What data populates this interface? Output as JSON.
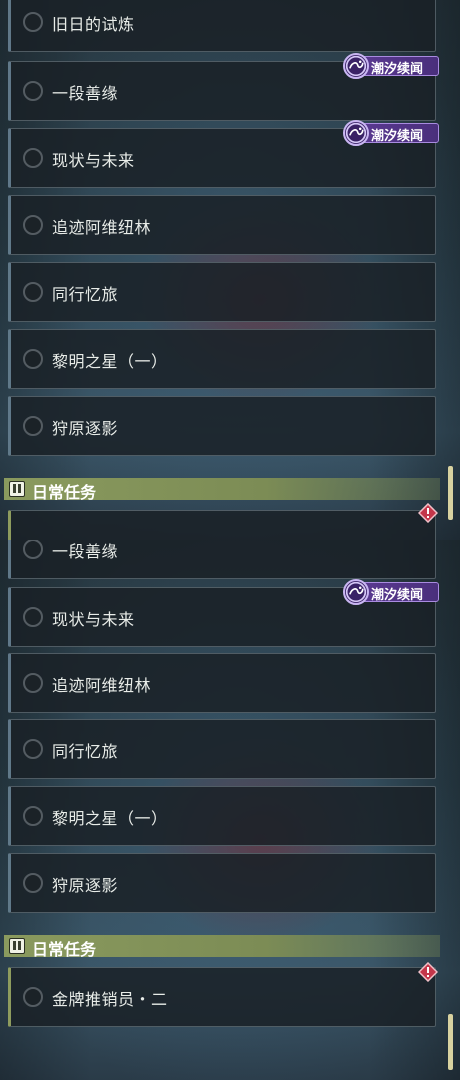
{
  "badge_label": "潮汐续闻",
  "section_daily": "日常任务",
  "colors": {
    "badge_purple": "#5b3a92",
    "section_green": "#8a9a5e",
    "warn_red": "#c4364a",
    "item_background": "#1a2126"
  },
  "icons": {
    "radio": "empty-circle-icon",
    "badge": "tide-swirl-icon",
    "section": "double-bar-quest-icon",
    "warning": "red-diamond-alert-icon"
  },
  "top_list": {
    "items": [
      {
        "title": "旧日的试炼"
      },
      {
        "title": "一段善缘"
      },
      {
        "title": "现状与未来"
      },
      {
        "title": "追迹阿维纽林"
      },
      {
        "title": "同行忆旅"
      },
      {
        "title": "黎明之星（一）"
      },
      {
        "title": "狩原逐影"
      }
    ]
  },
  "bottom_list": {
    "items": [
      {
        "title": "一段善缘"
      },
      {
        "title": "现状与未来"
      },
      {
        "title": "追迹阿维纽林"
      },
      {
        "title": "同行忆旅"
      },
      {
        "title": "黎明之星（一）"
      },
      {
        "title": "狩原逐影"
      }
    ],
    "daily_items": [
      {
        "title": "金牌推销员・二"
      }
    ]
  }
}
